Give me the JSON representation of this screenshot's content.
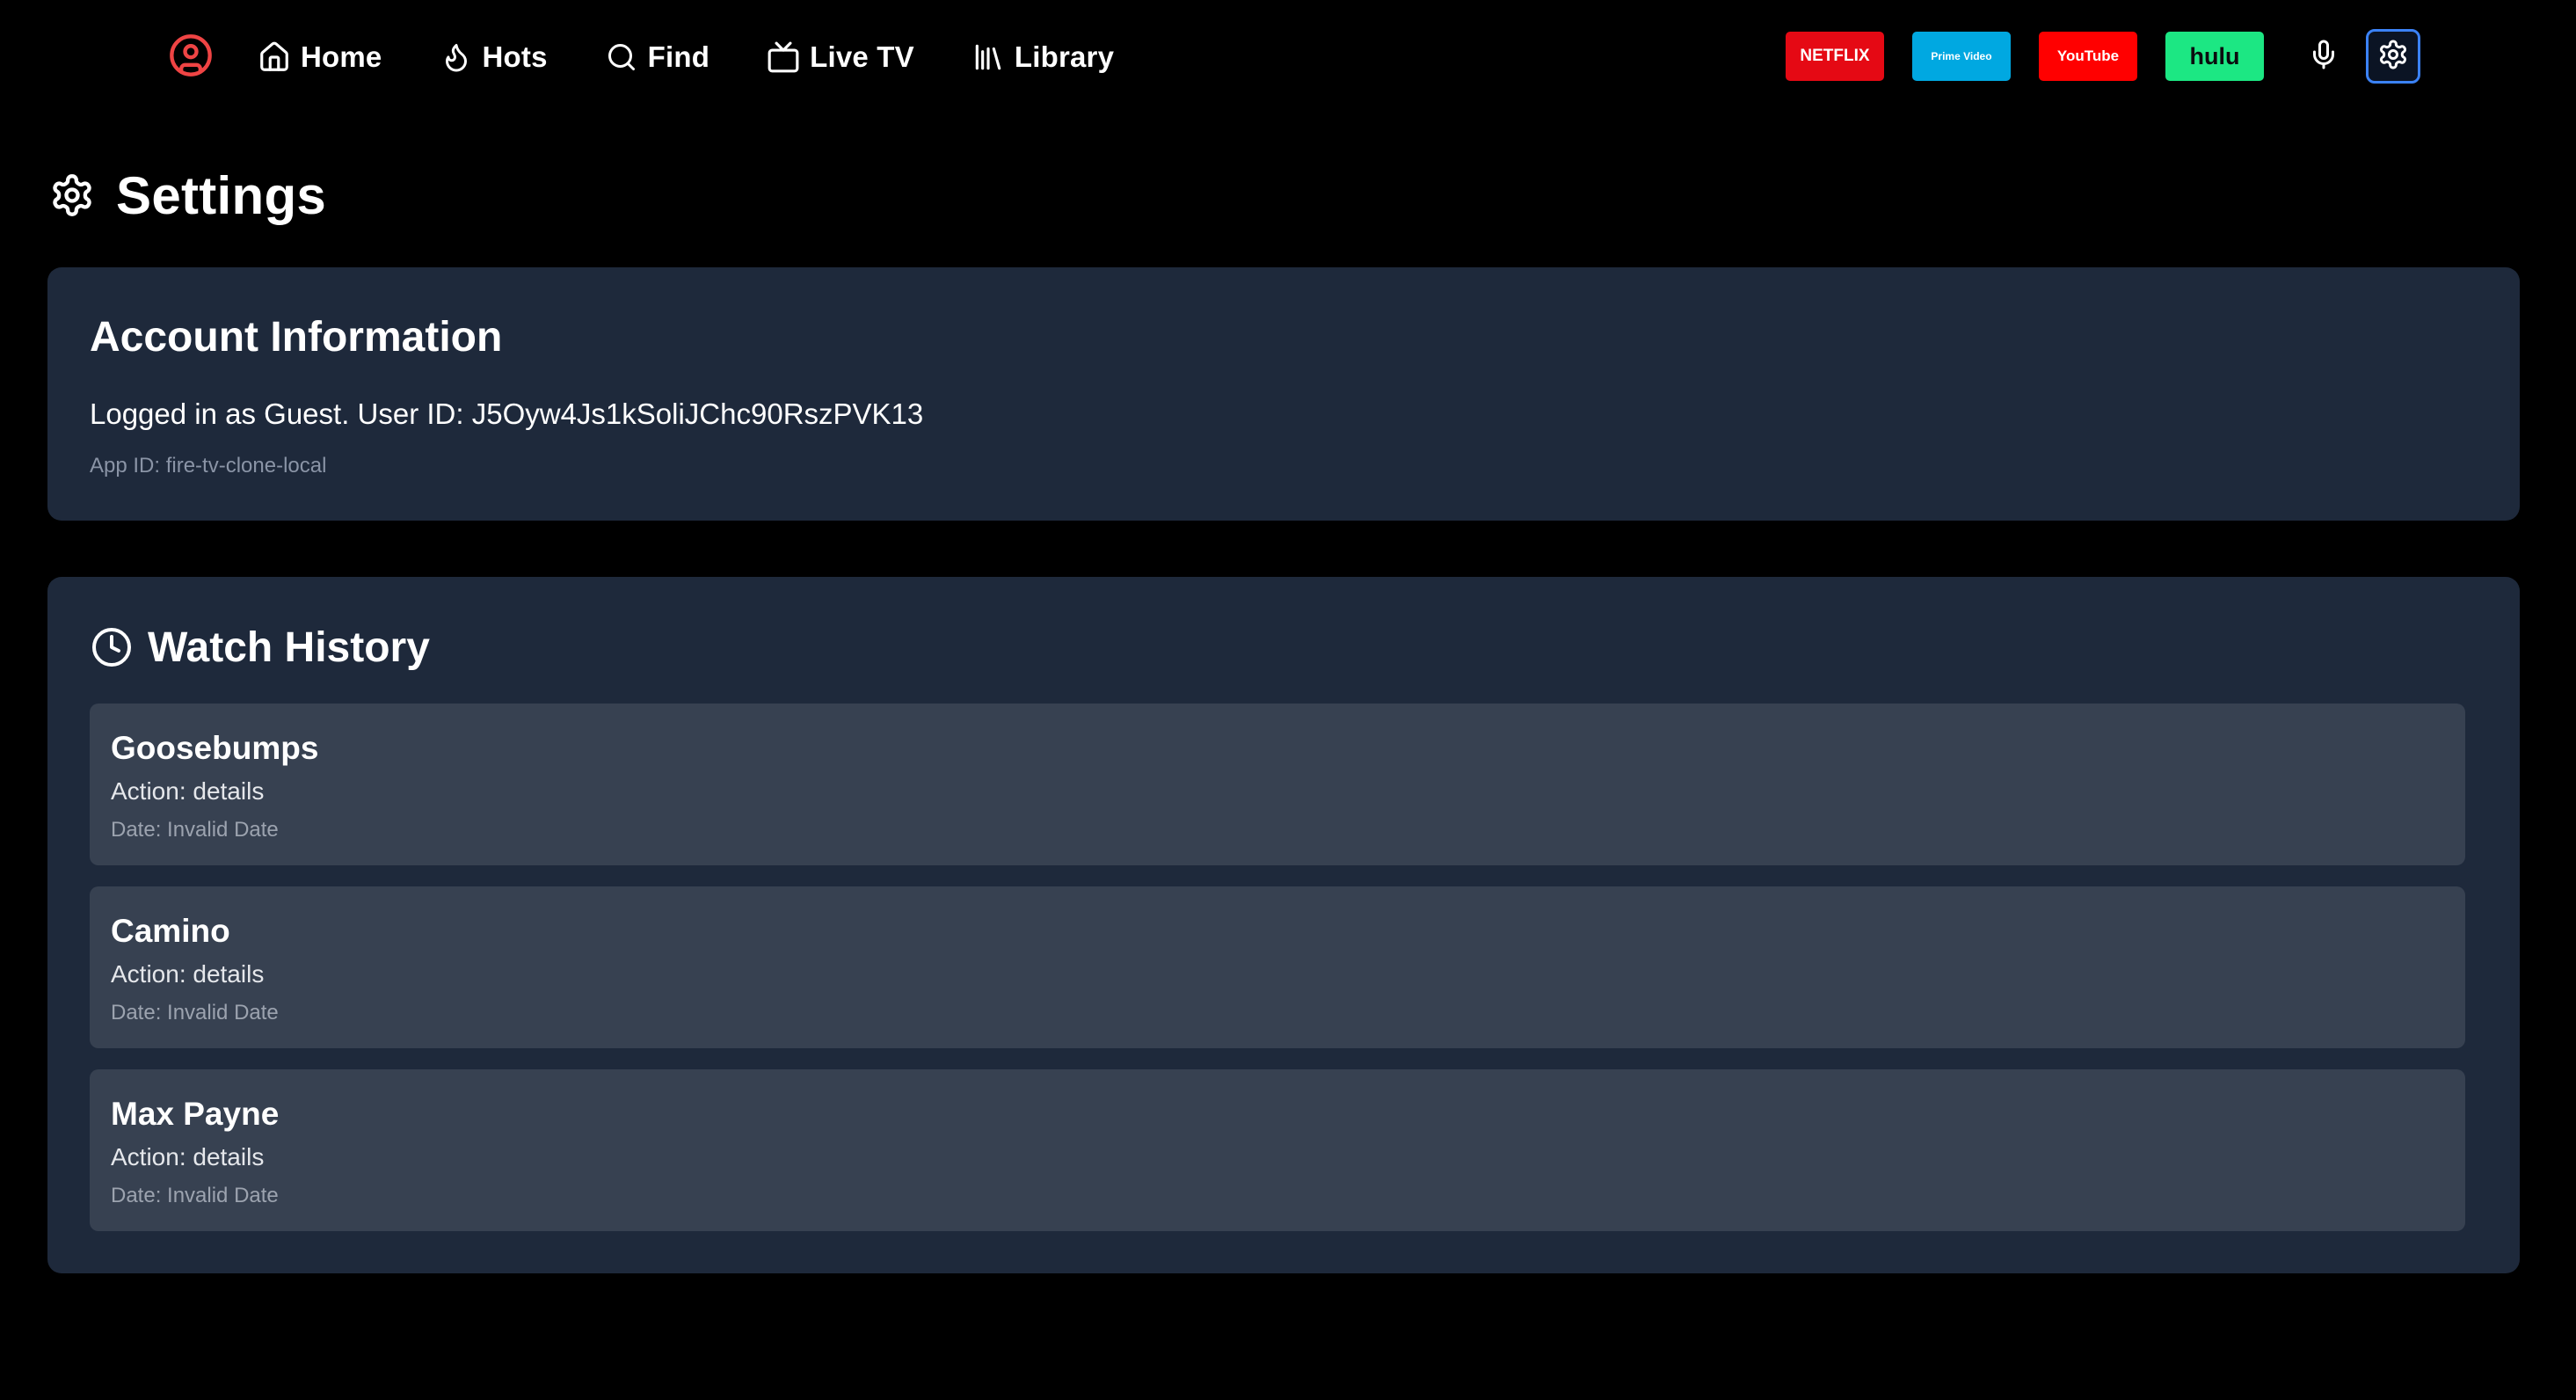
{
  "nav": {
    "profile_icon": "user-circle-icon",
    "items": [
      {
        "label": "Home",
        "icon": "home-icon"
      },
      {
        "label": "Hots",
        "icon": "flame-icon"
      },
      {
        "label": "Find",
        "icon": "search-icon"
      },
      {
        "label": "Live TV",
        "icon": "tv-icon"
      },
      {
        "label": "Library",
        "icon": "library-icon"
      }
    ],
    "apps": [
      {
        "label": "NETFLIX",
        "color": "#e50914"
      },
      {
        "label": "Prime Video",
        "color": "#00a8e1"
      },
      {
        "label": "YouTube",
        "color": "#ff0000"
      },
      {
        "label": "hulu",
        "color": "#1ce783"
      }
    ],
    "mic_icon": "microphone-icon",
    "settings_icon": "gear-icon",
    "active_color": "#3b82f6",
    "profile_color": "#ef4444"
  },
  "page": {
    "title": "Settings",
    "icon": "gear-icon"
  },
  "account": {
    "title": "Account Information",
    "logged_in_text": "Logged in as Guest. User ID: J5Oyw4Js1kSoliJChc90RszPVK13",
    "app_id_text": "App ID: fire-tv-clone-local"
  },
  "history": {
    "title": "Watch History",
    "icon": "clock-icon",
    "items": [
      {
        "title": "Goosebumps",
        "action": "Action: details",
        "date": "Date: Invalid Date"
      },
      {
        "title": "Camino",
        "action": "Action: details",
        "date": "Date: Invalid Date"
      },
      {
        "title": "Max Payne",
        "action": "Action: details",
        "date": "Date: Invalid Date"
      }
    ]
  },
  "colors": {
    "background": "#000000",
    "card": "#1e293b",
    "item": "#374151"
  }
}
